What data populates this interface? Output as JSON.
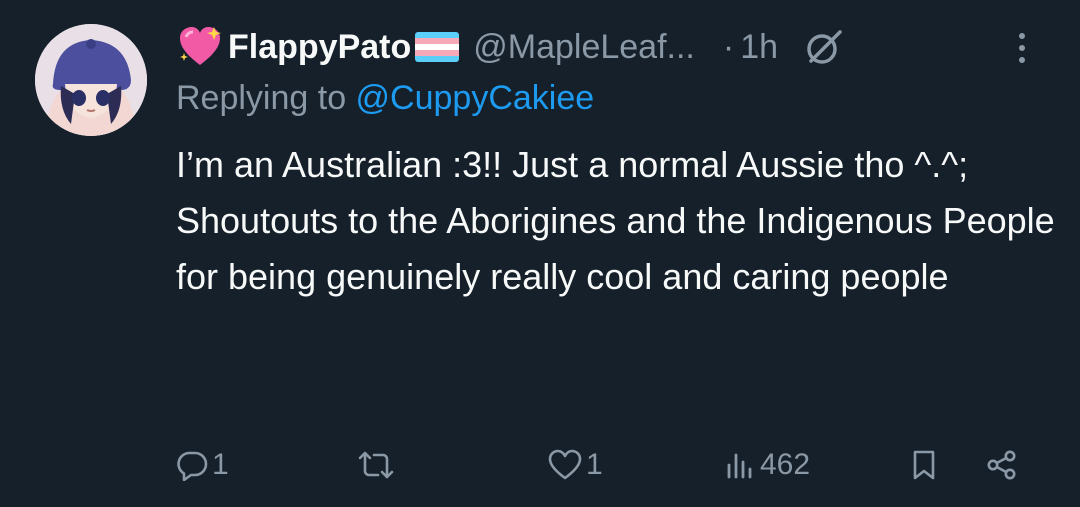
{
  "author": {
    "display_name": "FlappyPato",
    "handle": "@MapleLeaf...",
    "separator": "·",
    "time": "1h",
    "avatar_icon": "avatar-image",
    "name_prefix_icon": "sparkling-heart-emoji",
    "name_suffix_icon": "transgender-flag-emoji"
  },
  "reply": {
    "prefix": "Replying to ",
    "mention": "@CuppyCakiee"
  },
  "text": {
    "line1": "I’m an Australian :3!! Just a normal Aussie tho ^.^;",
    "line2": "Shoutouts to the Aborigines and the Indigenous People for being genuinely really cool and caring people"
  },
  "actions": {
    "reply_count": "1",
    "retweet_count": "",
    "like_count": "1",
    "views_count": "462"
  },
  "colors": {
    "background": "#15202b",
    "text": "#f7f9f9",
    "secondary": "#8b98a5",
    "link": "#1d9bf0"
  }
}
